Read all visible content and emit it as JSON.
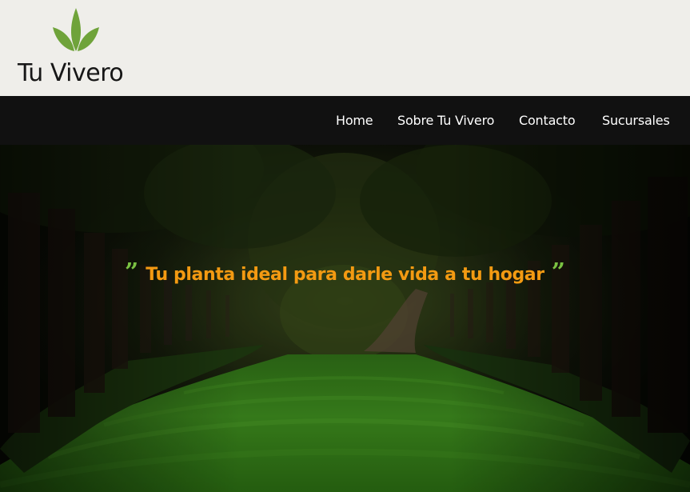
{
  "brand": {
    "name": "Tu Vivero",
    "logo_icon": "sprout-leaves-icon",
    "logo_color": "#6fa33a"
  },
  "nav": {
    "items": [
      {
        "label": "Home"
      },
      {
        "label": "Sobre Tu Vivero"
      },
      {
        "label": "Contacto"
      },
      {
        "label": "Sucursales"
      }
    ]
  },
  "hero": {
    "background": "forest-path-image",
    "open_quote": "”",
    "tagline": "Tu planta ideal para darle vida a tu hogar",
    "close_quote": "”",
    "quote_color": "#7ac142",
    "tagline_color": "#f39a12"
  }
}
